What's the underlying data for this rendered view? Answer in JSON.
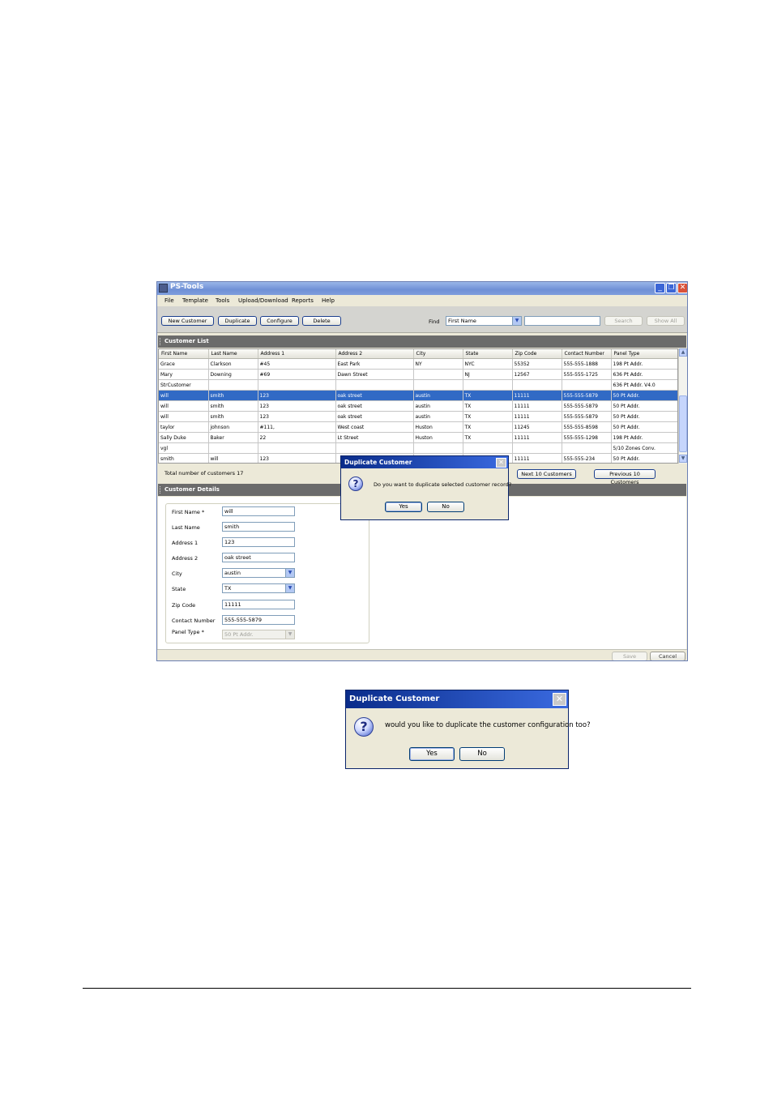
{
  "window": {
    "title": "PS-Tools",
    "min_icon": "_",
    "max_icon": "❐",
    "close_icon": "✕"
  },
  "menubar": [
    "File",
    "Template",
    "Tools",
    "Upload/Download",
    "Reports",
    "Help"
  ],
  "toolbar": {
    "new_customer": "New Customer",
    "duplicate": "Duplicate",
    "configure": "Configure",
    "delete": "Delete",
    "find_label": "Find",
    "find_field_value": "First Name",
    "find_text": "",
    "search": "Search",
    "show_all": "Show All"
  },
  "customer_list": {
    "section_title": "Customer List",
    "columns": [
      "First Name",
      "Last Name",
      "Address 1",
      "Address 2",
      "City",
      "State",
      "Zip Code",
      "Contact Number",
      "Panel Type"
    ],
    "rows": [
      [
        "Grace",
        "Clarkson",
        "#45",
        "East Park",
        "NY",
        "NYC",
        "55352",
        "555-555-1888",
        "198 Pt Addr."
      ],
      [
        "Mary",
        "Downing",
        "#69",
        "Dawn Street",
        "",
        "NJ",
        "12567",
        "555-555-1725",
        "636 Pt Addr."
      ],
      [
        "StrCustomer",
        "",
        "",
        "",
        "",
        "",
        "",
        "",
        "636 Pt Addr. V4.0"
      ],
      [
        "will",
        "smith",
        "123",
        "oak street",
        "austin",
        "TX",
        "11111",
        "555-555-5879",
        "50 Pt Addr."
      ],
      [
        "will",
        "smith",
        "123",
        "oak street",
        "austin",
        "TX",
        "11111",
        "555-555-5879",
        "50 Pt Addr."
      ],
      [
        "will",
        "smith",
        "123",
        "oak street",
        "austin",
        "TX",
        "11111",
        "555-555-5879",
        "50 Pt Addr."
      ],
      [
        "taylor",
        "johnson",
        "#111,",
        "West coast",
        "Huston",
        "TX",
        "11245",
        "555-555-8598",
        "50 Pt Addr."
      ],
      [
        "Sally Duke",
        "Baker",
        "22",
        "Lt Street",
        "Huston",
        "TX",
        "11111",
        "555-555-1298",
        "198 Pt Addr."
      ],
      [
        "vgl",
        "",
        "",
        "",
        "",
        "",
        "",
        "",
        "5/10 Zones Conv."
      ],
      [
        "smith",
        "will",
        "123",
        "",
        "",
        "",
        "11111",
        "555-555-234",
        "50 Pt Addr."
      ]
    ],
    "selected_row": 3,
    "total_label": "Total number of customers 17",
    "next_button": "Next 10 Customers",
    "previous_button": "Previous 10 Customers"
  },
  "customer_details": {
    "section_title": "Customer Details",
    "first_name_label": "First Name *",
    "first_name_value": "will",
    "last_name_label": "Last Name",
    "last_name_value": "smith",
    "address1_label": "Address 1",
    "address1_value": "123",
    "address2_label": "Address 2",
    "address2_value": "oak street",
    "city_label": "City",
    "city_value": "austin",
    "state_label": "State",
    "state_value": "TX",
    "zip_label": "Zip Code",
    "zip_value": "11111",
    "contact_label": "Contact Number",
    "contact_value": "555-555-5879",
    "panel_type_label": "Panel Type *",
    "panel_type_value": "50 Pt Addr.",
    "save": "Save",
    "cancel": "Cancel"
  },
  "dialog1": {
    "title": "Duplicate Customer",
    "message": "Do you want to duplicate selected customer record?",
    "yes": "Yes",
    "no": "No",
    "icon": "question-icon"
  },
  "dialog2": {
    "title": "Duplicate Customer",
    "message": "would you like to duplicate the customer configuration too?",
    "yes": "Yes",
    "no": "No",
    "icon": "question-icon"
  },
  "colors": {
    "selection": "#316ac5",
    "titlebar": "#0a2c8a",
    "section_header": "#6b6b6b",
    "window_bg": "#ece9d8"
  }
}
